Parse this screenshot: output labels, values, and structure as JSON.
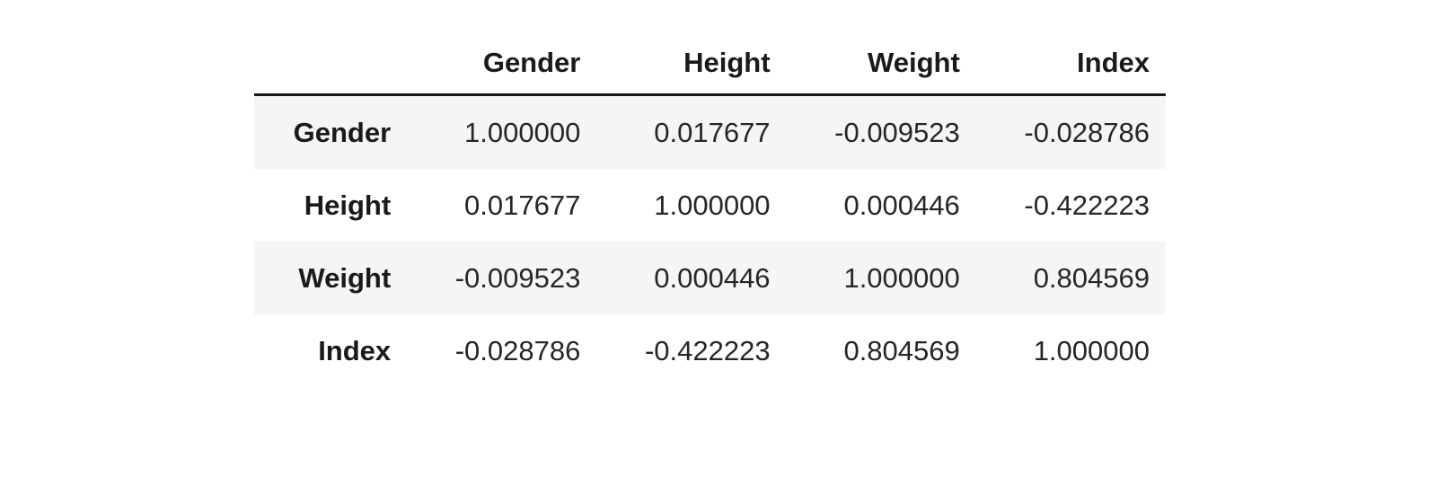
{
  "table": {
    "index_header": "",
    "columns": [
      "Gender",
      "Height",
      "Weight",
      "Index"
    ],
    "index": [
      "Gender",
      "Height",
      "Weight",
      "Index"
    ],
    "rows": [
      {
        "label": "Gender",
        "cells": [
          "1.000000",
          "0.017677",
          "-0.009523",
          "-0.028786"
        ]
      },
      {
        "label": "Height",
        "cells": [
          "0.017677",
          "1.000000",
          "0.000446",
          "-0.422223"
        ]
      },
      {
        "label": "Weight",
        "cells": [
          "-0.009523",
          "0.000446",
          "1.000000",
          "0.804569"
        ]
      },
      {
        "label": "Index",
        "cells": [
          "-0.028786",
          "-0.422223",
          "0.804569",
          "1.000000"
        ]
      }
    ]
  },
  "chart_data": {
    "type": "table",
    "title": "",
    "subtitle": "",
    "xlabel": "",
    "ylabel": "",
    "categories": [
      "Gender",
      "Height",
      "Weight",
      "Index"
    ],
    "index": [
      "Gender",
      "Height",
      "Weight",
      "Index"
    ],
    "columns": [
      "Gender",
      "Height",
      "Weight",
      "Index"
    ],
    "matrix": [
      [
        1.0,
        0.017677,
        -0.009523,
        -0.028786
      ],
      [
        0.017677,
        1.0,
        0.000446,
        -0.422223
      ],
      [
        -0.009523,
        0.000446,
        1.0,
        0.804569
      ],
      [
        -0.028786,
        -0.422223,
        0.804569,
        1.0
      ]
    ],
    "series": [
      {
        "name": "Gender",
        "values": [
          1.0,
          0.017677,
          -0.009523,
          -0.028786
        ]
      },
      {
        "name": "Height",
        "values": [
          0.017677,
          1.0,
          0.000446,
          -0.422223
        ]
      },
      {
        "name": "Weight",
        "values": [
          -0.009523,
          0.000446,
          1.0,
          0.804569
        ]
      },
      {
        "name": "Index",
        "values": [
          -0.028786,
          -0.422223,
          0.804569,
          1.0
        ]
      }
    ],
    "value_range": [
      -0.422223,
      1.0
    ],
    "decimals": 6,
    "grid": false,
    "legend": "none"
  },
  "style": {
    "background": "#ffffff",
    "text_color": "#1a1a1a",
    "value_color": "#262626",
    "stripe_color": "#f5f5f5",
    "rule_color": "#1a1a1a"
  }
}
